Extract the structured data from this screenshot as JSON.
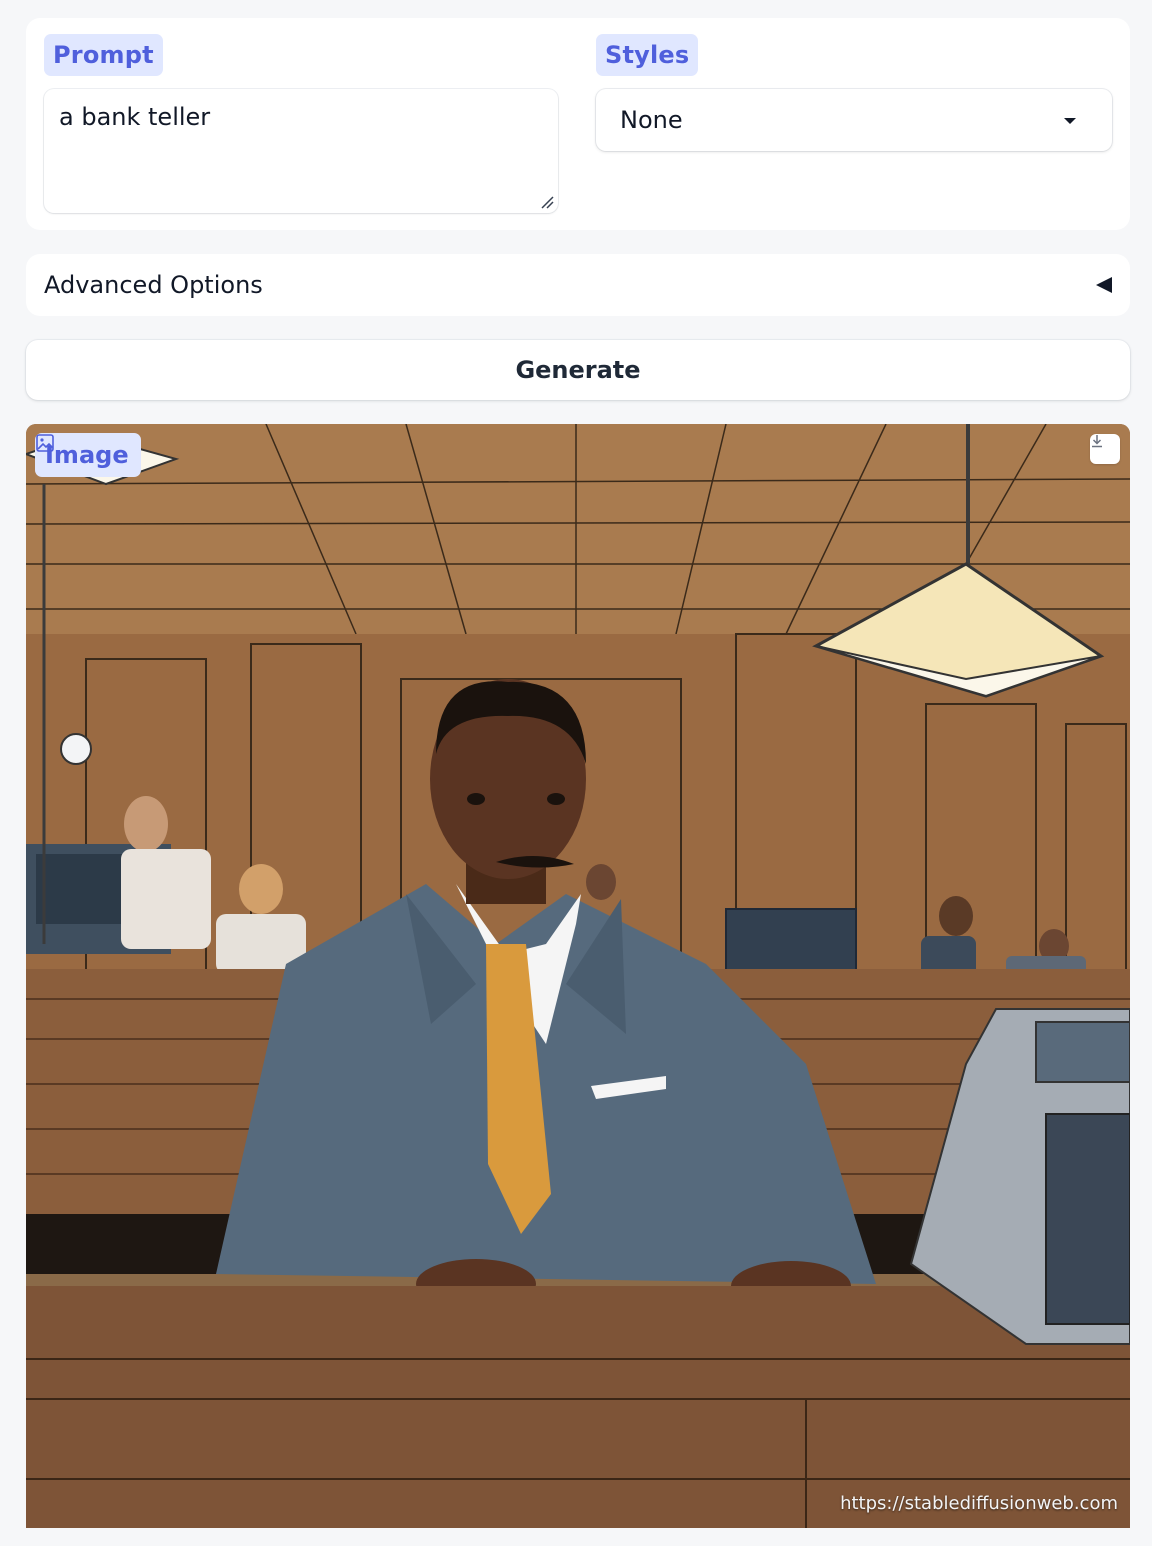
{
  "prompt": {
    "label": "Prompt",
    "value": "a bank teller"
  },
  "styles": {
    "label": "Styles",
    "selected": "None"
  },
  "advanced": {
    "label": "Advanced Options"
  },
  "generate": {
    "label": "Generate"
  },
  "output": {
    "label": "Image",
    "watermark": "https://stablediffusionweb.com"
  },
  "colors": {
    "accent": "#4f5fdc",
    "chip_bg": "#e0e7ff",
    "page_bg": "#f6f7f9"
  }
}
